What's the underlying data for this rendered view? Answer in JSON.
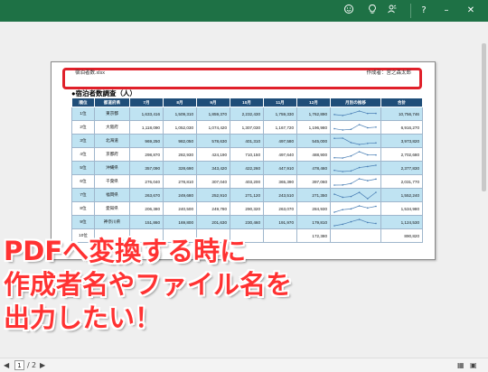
{
  "titlebar": {
    "icons": [
      "smiley-icon",
      "lightbulb-icon",
      "people-icon",
      "help-icon",
      "minimize-icon",
      "close-icon"
    ],
    "help_label": "?",
    "minimize_label": "–",
    "close_label": "✕"
  },
  "header": {
    "file_name": "宿泊者数.xlsx",
    "author": "作成者：宮之森太郎"
  },
  "document": {
    "title": "●宿泊者数調査（人）"
  },
  "table": {
    "columns": [
      "順位",
      "都道府県",
      "7月",
      "8月",
      "9月",
      "10月",
      "11月",
      "12月",
      "月別の推移",
      "合計"
    ],
    "rows": [
      {
        "rank": "1位",
        "pref": "東京都",
        "values": [
          "1,633,416",
          "1,509,310",
          "1,859,370",
          "2,232,430",
          "1,759,330",
          "1,762,890"
        ],
        "total": "10,756,746",
        "trend": [
          0.45,
          0.3,
          0.6,
          1.0,
          0.62,
          0.63
        ]
      },
      {
        "rank": "2位",
        "pref": "大阪府",
        "values": [
          "1,118,090",
          "1,052,030",
          "1,074,420",
          "1,307,030",
          "1,167,720",
          "1,196,980"
        ],
        "total": "6,916,270",
        "trend": [
          0.35,
          0.15,
          0.25,
          1.0,
          0.5,
          0.6
        ]
      },
      {
        "rank": "3位",
        "pref": "北海道",
        "values": [
          "969,250",
          "982,050",
          "578,630",
          "401,310",
          "497,580",
          "545,000"
        ],
        "total": "3,973,820",
        "trend": [
          0.97,
          1.0,
          0.3,
          0.0,
          0.17,
          0.25
        ]
      },
      {
        "rank": "4位",
        "pref": "京都府",
        "values": [
          "298,870",
          "282,930",
          "424,190",
          "710,150",
          "497,640",
          "488,900"
        ],
        "total": "2,702,680",
        "trend": [
          0.04,
          0.0,
          0.33,
          1.0,
          0.5,
          0.48
        ]
      },
      {
        "rank": "5位",
        "pref": "沖縄県",
        "values": [
          "357,090",
          "328,690",
          "343,420",
          "422,260",
          "447,910",
          "478,460"
        ],
        "total": "2,377,830",
        "trend": [
          0.19,
          0.0,
          0.1,
          0.63,
          0.8,
          1.0
        ]
      },
      {
        "rank": "6位",
        "pref": "千葉県",
        "values": [
          "276,040",
          "278,810",
          "307,040",
          "403,200",
          "365,390",
          "397,060"
        ],
        "total": "2,031,770",
        "trend": [
          0.0,
          0.02,
          0.25,
          1.0,
          0.7,
          0.95
        ]
      },
      {
        "rank": "7位",
        "pref": "福岡県",
        "values": [
          "263,670",
          "249,680",
          "252,910",
          "271,120",
          "243,510",
          "271,350"
        ],
        "total": "1,552,240",
        "trend": [
          0.7,
          0.22,
          0.34,
          0.99,
          0.0,
          1.0
        ]
      },
      {
        "rank": "8位",
        "pref": "愛知県",
        "values": [
          "206,380",
          "240,500",
          "249,780",
          "290,320",
          "263,070",
          "284,930"
        ],
        "total": "1,534,980",
        "trend": [
          0.0,
          0.4,
          0.52,
          1.0,
          0.67,
          0.93
        ]
      },
      {
        "rank": "9位",
        "pref": "神奈川県",
        "values": [
          "151,860",
          "169,800",
          "201,630",
          "230,460",
          "191,970",
          "179,810"
        ],
        "total": "1,124,530",
        "trend": [
          0.0,
          0.23,
          0.63,
          1.0,
          0.51,
          0.36
        ]
      },
      {
        "rank": "10位",
        "pref": "",
        "values": [
          "",
          "",
          "",
          "",
          "",
          "172,380"
        ],
        "total": "890,820",
        "trend": []
      }
    ]
  },
  "overlay_caption": {
    "line1": "PDFへ変換する時に",
    "line2": "作成者名やファイル名を",
    "line3": "出力したい！"
  },
  "pager": {
    "current": "1",
    "separator": "/",
    "total": "2"
  },
  "colors": {
    "titlebar": "#1e7145",
    "accent_red": "#e0202a",
    "header_blue": "#1f4e79",
    "row_alt": "#bfe3f2"
  }
}
